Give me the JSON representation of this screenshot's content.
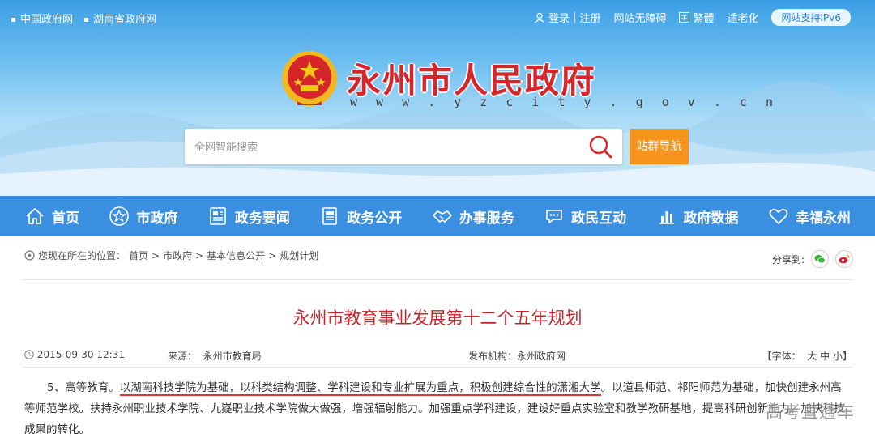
{
  "topbar": {
    "left_links": [
      "中国政府网",
      "湖南省政府网"
    ],
    "login": "登录",
    "sep": "|",
    "register": "注册",
    "accessible": "网站无障碍",
    "traditional": "繁體",
    "elderly": "适老化",
    "ipv6": "网站支持IPv6"
  },
  "header": {
    "title": "永州市人民政府",
    "url": "w w w . y z c i t y . g o v . c n",
    "search_placeholder": "全网智能搜索",
    "site_nav": "站群导航"
  },
  "nav": [
    {
      "label": "首页",
      "icon": "home-icon"
    },
    {
      "label": "市政府",
      "icon": "star-icon"
    },
    {
      "label": "政务要闻",
      "icon": "news-icon"
    },
    {
      "label": "政务公开",
      "icon": "document-icon"
    },
    {
      "label": "办事服务",
      "icon": "handshake-icon"
    },
    {
      "label": "政民互动",
      "icon": "chat-icon"
    },
    {
      "label": "政府数据",
      "icon": "bar-chart-icon"
    },
    {
      "label": "幸福永州",
      "icon": "heart-icon"
    }
  ],
  "breadcrumb": {
    "prefix": "您现在所在的位置：",
    "items": [
      "首页",
      "市政府",
      "基本信息公开",
      "规划计划"
    ],
    "sep": ">"
  },
  "share": {
    "label": "分享到:",
    "icons": [
      "wechat-icon",
      "weibo-icon"
    ]
  },
  "article": {
    "title": "永州市教育事业发展第十二个五年规划",
    "date": "2015-09-30 12:31",
    "source_label": "来源：",
    "source": "永州市教育局",
    "publisher_label": "发布机构：",
    "publisher": "永州政府网",
    "font_label": "【字体：",
    "font_large": "大",
    "font_medium": "中",
    "font_small": "小",
    "font_end": "】",
    "para_lead": "5、高等教育。",
    "para_highlight": "以湖南科技学院为基础，以科类结构调整、学科建设和专业扩展为重点，积极创建综合性的潇湘大学",
    "para_rest": "。以道县师范、祁阳师范为基础，加快创建永州高等师范学校。扶持永州职业技术学院、九嶷职业技术学院做大做强，增强辐射能力。加强重点学科建设，建设好重点实验室和教学教研基地，提高科研创新能力，加快科技成果的转化。"
  },
  "watermark": "高考直通车",
  "colors": {
    "nav_bg": "#3b8fe0",
    "title_red": "#d6262b",
    "orange": "#f7941d",
    "underline": "#e03030"
  }
}
